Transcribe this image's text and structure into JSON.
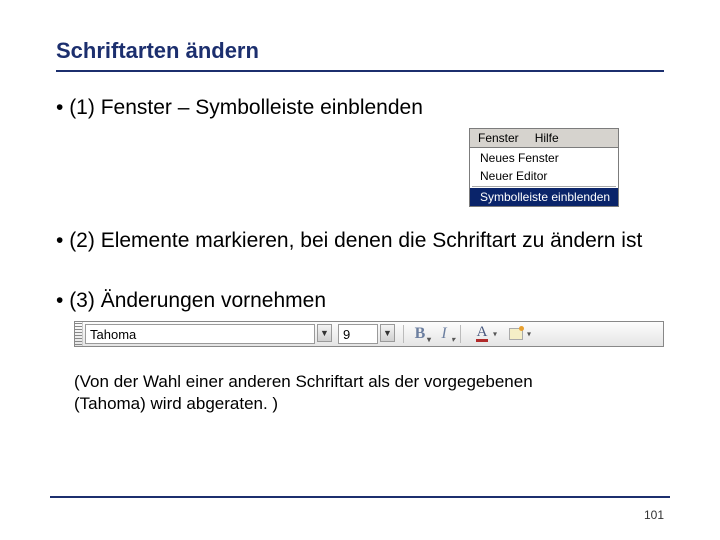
{
  "title": "Schriftarten ändern",
  "bullets": {
    "b1": "(1) Fenster – Symbolleiste einblenden",
    "b2": "(2) Elemente markieren, bei denen die Schriftart zu ändern ist",
    "b3": "(3) Änderungen vornehmen"
  },
  "menu": {
    "bar": {
      "fenster": "Fenster",
      "hilfe": "Hilfe"
    },
    "items": {
      "neues_fenster": "Neues Fenster",
      "neuer_editor": "Neuer Editor",
      "symbolleiste": "Symbolleiste einblenden"
    }
  },
  "toolbar": {
    "font": "Tahoma",
    "size": "9",
    "bold": "B",
    "italic": "I",
    "colorA": "A"
  },
  "note_line1": "(Von der Wahl einer anderen Schriftart als der vorgegebenen",
  "note_line2": "(Tahoma) wird abgeraten. )",
  "page": "101"
}
